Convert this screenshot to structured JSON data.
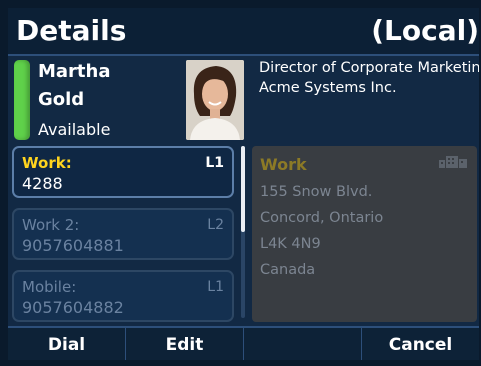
{
  "header": {
    "title": "Details",
    "scope": "(Local)"
  },
  "contact": {
    "first_name": "Martha",
    "last_name": "Gold",
    "presence": "Available",
    "presence_color": "#5fd14a",
    "title": "Director of Corporate Marketing",
    "company": "Acme Systems Inc."
  },
  "numbers": [
    {
      "label": "Work:",
      "line": "L1",
      "value": "4288",
      "selected": true
    },
    {
      "label": "Work 2:",
      "line": "L2",
      "value": "9057604881",
      "selected": false
    },
    {
      "label": "Mobile:",
      "line": "L1",
      "value": "9057604882",
      "selected": false
    }
  ],
  "address": {
    "title": "Work",
    "icon": "building-icon",
    "street": "155 Snow Blvd.",
    "city": "Concord, Ontario",
    "postal": "L4K 4N9",
    "country": "Canada"
  },
  "softkeys": {
    "dial": "Dial",
    "edit": "Edit",
    "blank": "",
    "cancel": "Cancel"
  },
  "colors": {
    "accent_yellow": "#ffd41e",
    "background": "#122944",
    "panel": "#393d42"
  }
}
